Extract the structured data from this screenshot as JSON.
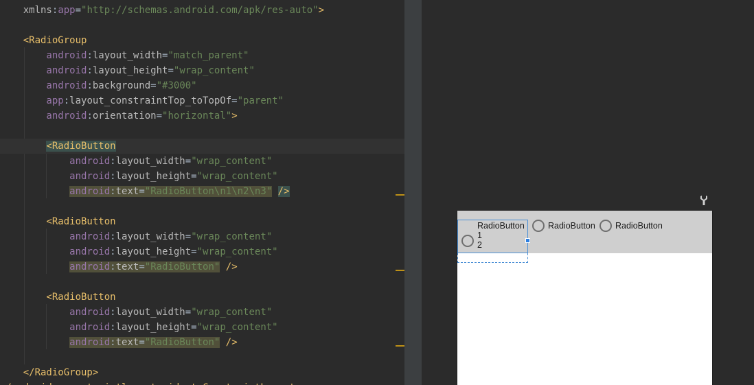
{
  "editor": {
    "lines": [
      {
        "tag_indent": "    ",
        "parts": [
          [
            "t-attr",
            "xmlns"
          ],
          [
            "t-eq",
            ":"
          ],
          [
            "t-ns",
            "app"
          ],
          [
            "t-eq",
            "="
          ],
          [
            "t-val",
            "\"http://schemas.android.com/apk/res-auto\""
          ],
          [
            "t-tag",
            ">"
          ]
        ]
      },
      {
        "parts": []
      },
      {
        "parts": [
          [
            "t-tag",
            "    <RadioGroup"
          ]
        ]
      },
      {
        "parts": [
          [
            "t-ns",
            "        android"
          ],
          [
            "t-eq",
            ":"
          ],
          [
            "t-attr",
            "layout_width"
          ],
          [
            "t-eq",
            "="
          ],
          [
            "t-val",
            "\"match_parent\""
          ]
        ]
      },
      {
        "parts": [
          [
            "t-ns",
            "        android"
          ],
          [
            "t-eq",
            ":"
          ],
          [
            "t-attr",
            "layout_height"
          ],
          [
            "t-eq",
            "="
          ],
          [
            "t-val",
            "\"wrap_content\""
          ]
        ]
      },
      {
        "parts": [
          [
            "t-ns",
            "        android"
          ],
          [
            "t-eq",
            ":"
          ],
          [
            "t-attr",
            "background"
          ],
          [
            "t-eq",
            "="
          ],
          [
            "t-val",
            "\"#3000\""
          ]
        ]
      },
      {
        "parts": [
          [
            "t-ns",
            "        app"
          ],
          [
            "t-eq",
            ":"
          ],
          [
            "t-attr",
            "layout_constraintTop_toTopOf"
          ],
          [
            "t-eq",
            "="
          ],
          [
            "t-val",
            "\"parent\""
          ]
        ]
      },
      {
        "parts": [
          [
            "t-ns",
            "        android"
          ],
          [
            "t-eq",
            ":"
          ],
          [
            "t-attr",
            "orientation"
          ],
          [
            "t-eq",
            "="
          ],
          [
            "t-val",
            "\"horizontal\""
          ],
          [
            "t-tag",
            ">"
          ]
        ]
      },
      {
        "parts": []
      },
      {
        "hl": true,
        "parts": [
          [
            "t-tag",
            "        "
          ],
          [
            "t-tag t-tagmatch",
            "<RadioButton"
          ]
        ]
      },
      {
        "parts": [
          [
            "t-ns",
            "            android"
          ],
          [
            "t-eq",
            ":"
          ],
          [
            "t-attr",
            "layout_width"
          ],
          [
            "t-eq",
            "="
          ],
          [
            "t-val",
            "\"wrap_content\""
          ]
        ]
      },
      {
        "parts": [
          [
            "t-ns",
            "            android"
          ],
          [
            "t-eq",
            ":"
          ],
          [
            "t-attr",
            "layout_height"
          ],
          [
            "t-eq",
            "="
          ],
          [
            "t-val",
            "\"wrap_content\""
          ]
        ]
      },
      {
        "parts": [
          [
            "t-ns",
            "            "
          ],
          [
            "t-ns t-warn",
            "android"
          ],
          [
            "t-eq t-warn",
            ":"
          ],
          [
            "t-attr t-warn",
            "text"
          ],
          [
            "t-eq t-warn",
            "="
          ],
          [
            "t-val t-warn",
            "\"RadioButton\\n1\\n2\\n3\""
          ],
          [
            "t-eq",
            " "
          ],
          [
            "t-tag t-tagmatch",
            "/>"
          ]
        ]
      },
      {
        "parts": []
      },
      {
        "parts": [
          [
            "t-tag",
            "        <RadioButton"
          ]
        ]
      },
      {
        "parts": [
          [
            "t-ns",
            "            android"
          ],
          [
            "t-eq",
            ":"
          ],
          [
            "t-attr",
            "layout_width"
          ],
          [
            "t-eq",
            "="
          ],
          [
            "t-val",
            "\"wrap_content\""
          ]
        ]
      },
      {
        "parts": [
          [
            "t-ns",
            "            android"
          ],
          [
            "t-eq",
            ":"
          ],
          [
            "t-attr",
            "layout_height"
          ],
          [
            "t-eq",
            "="
          ],
          [
            "t-val",
            "\"wrap_content\""
          ]
        ]
      },
      {
        "parts": [
          [
            "t-ns",
            "            "
          ],
          [
            "t-ns t-warn",
            "android"
          ],
          [
            "t-eq t-warn",
            ":"
          ],
          [
            "t-attr t-warn",
            "text"
          ],
          [
            "t-eq t-warn",
            "="
          ],
          [
            "t-val t-warn",
            "\"RadioButton\""
          ],
          [
            "t-eq",
            " "
          ],
          [
            "t-tag",
            "/>"
          ]
        ]
      },
      {
        "parts": []
      },
      {
        "parts": [
          [
            "t-tag",
            "        <RadioButton"
          ]
        ]
      },
      {
        "parts": [
          [
            "t-ns",
            "            android"
          ],
          [
            "t-eq",
            ":"
          ],
          [
            "t-attr",
            "layout_width"
          ],
          [
            "t-eq",
            "="
          ],
          [
            "t-val",
            "\"wrap_content\""
          ]
        ]
      },
      {
        "parts": [
          [
            "t-ns",
            "            android"
          ],
          [
            "t-eq",
            ":"
          ],
          [
            "t-attr",
            "layout_height"
          ],
          [
            "t-eq",
            "="
          ],
          [
            "t-val",
            "\"wrap_content\""
          ]
        ]
      },
      {
        "parts": [
          [
            "t-ns",
            "            "
          ],
          [
            "t-ns t-warn",
            "android"
          ],
          [
            "t-eq t-warn",
            ":"
          ],
          [
            "t-attr t-warn",
            "text"
          ],
          [
            "t-eq t-warn",
            "="
          ],
          [
            "t-val t-warn",
            "\"RadioButton\""
          ],
          [
            "t-eq",
            " "
          ],
          [
            "t-tag",
            "/>"
          ]
        ]
      },
      {
        "parts": []
      },
      {
        "parts": [
          [
            "t-tag",
            "    </RadioGroup>"
          ]
        ]
      },
      {
        "parts": [
          [
            "t-tag",
            "</androidx.constraintlayout.widget.ConstraintLayout>"
          ]
        ]
      }
    ]
  },
  "preview": {
    "radio_buttons": [
      {
        "text": "RadioButton\n1\n2"
      },
      {
        "text": "RadioButton"
      },
      {
        "text": "RadioButton"
      }
    ],
    "icons": {
      "wrench": "wrench-icon"
    }
  },
  "colors": {
    "editor_bg": "#2b2b2b",
    "tag": "#e8bf6a",
    "namespace": "#9876aa",
    "value": "#6a8759",
    "radiogroup_bg": "#cfcfcf",
    "selection": "#4a8fd6",
    "gutter_mark": "#be9117"
  }
}
